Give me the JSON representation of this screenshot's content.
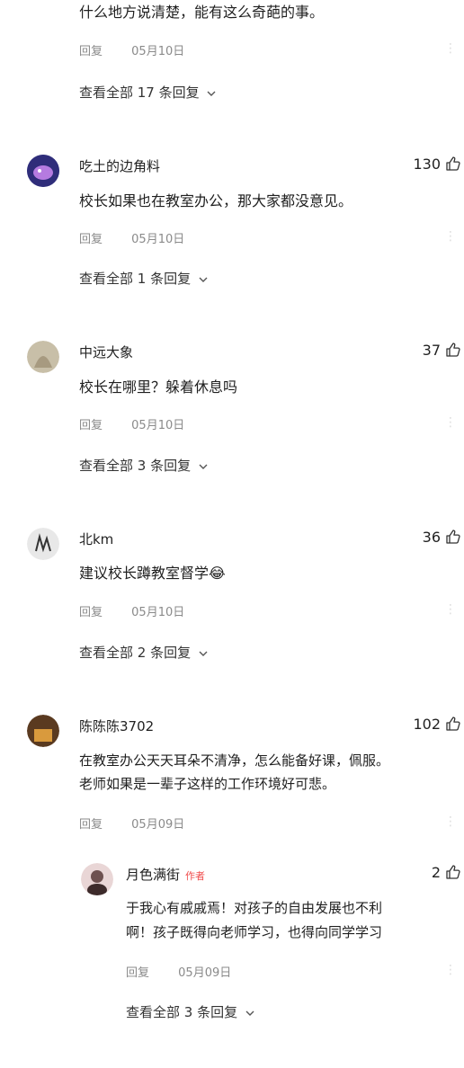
{
  "c0": {
    "text": "什么地方说清楚，能有这么奇葩的事。",
    "reply": "回复",
    "date": "05月10日",
    "viewall": "查看全部 17 条回复"
  },
  "c1": {
    "name": "吃土的边角料",
    "likes": "130",
    "text": "校长如果也在教室办公，那大家都没意见。",
    "reply": "回复",
    "date": "05月10日",
    "viewall": "查看全部 1 条回复"
  },
  "c2": {
    "name": "中远大象",
    "likes": "37",
    "text": "校长在哪里？躲着休息吗",
    "reply": "回复",
    "date": "05月10日",
    "viewall": "查看全部 3 条回复"
  },
  "c3": {
    "name": "北km",
    "likes": "36",
    "text": "建议校长蹲教室督学",
    "emoji": "😂",
    "reply": "回复",
    "date": "05月10日",
    "viewall": "查看全部 2 条回复"
  },
  "c4": {
    "name": "陈陈陈3702",
    "likes": "102",
    "text1": "在教室办公天天耳朵不清净，怎么能备好课，佩服。",
    "text2": "老师如果是一辈子这样的工作环境好可悲。",
    "reply": "回复",
    "date": "05月09日"
  },
  "r1": {
    "name": "月色满街",
    "badge": "作者",
    "likes": "2",
    "text1": "于我心有戚戚焉！对孩子的自由发展也不利",
    "text2": "啊！孩子既得向老师学习，也得向同学学习",
    "reply": "回复",
    "date": "05月09日",
    "viewall": "查看全部 3 条回复"
  },
  "icons": [
    "like-icon",
    "chevron-down-icon",
    "more-icon"
  ]
}
